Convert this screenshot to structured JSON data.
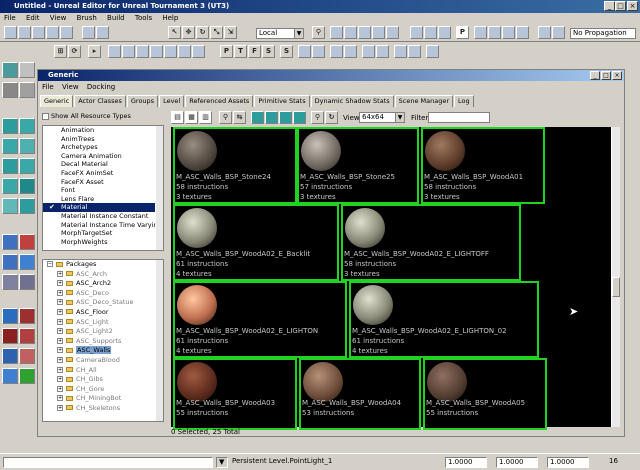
{
  "app": {
    "title": "Untitled - Unreal Editor for Unreal Tournament 3 (UT3)",
    "menu": [
      "File",
      "Edit",
      "View",
      "Brush",
      "Build",
      "Tools",
      "Help"
    ]
  },
  "main_toolbar": {
    "coord_system": "Local",
    "propagation": "No Propagation",
    "letter_buttons": [
      "P",
      "T",
      "F",
      "S",
      "S"
    ],
    "p_button": "P"
  },
  "generic": {
    "title": "Generic",
    "menu": [
      "File",
      "View",
      "Docking"
    ],
    "tabs": [
      "Generic",
      "Actor Classes",
      "Groups",
      "Level",
      "Referenced Assets",
      "Primitive Stats",
      "Dynamic Shadow Stats",
      "Scene Manager",
      "Log"
    ],
    "show_all_label": "Show All Resource Types",
    "resource_types": [
      {
        "label": "Animation",
        "checked": false,
        "selected": false
      },
      {
        "label": "AnimTrees",
        "checked": false,
        "selected": false
      },
      {
        "label": "Archetypes",
        "checked": false,
        "selected": false
      },
      {
        "label": "Camera Animation",
        "checked": false,
        "selected": false
      },
      {
        "label": "Decal Material",
        "checked": false,
        "selected": false
      },
      {
        "label": "FaceFX AnimSet",
        "checked": false,
        "selected": false
      },
      {
        "label": "FaceFX Asset",
        "checked": false,
        "selected": false
      },
      {
        "label": "Font",
        "checked": false,
        "selected": false
      },
      {
        "label": "Lens Flare",
        "checked": false,
        "selected": false
      },
      {
        "label": "Material",
        "checked": true,
        "selected": true
      },
      {
        "label": "Material Instance Constant",
        "checked": false,
        "selected": false
      },
      {
        "label": "Material Instance Time Varying",
        "checked": false,
        "selected": false
      },
      {
        "label": "MorphTargetSet",
        "checked": false,
        "selected": false
      },
      {
        "label": "MorphWeights",
        "checked": false,
        "selected": false
      }
    ],
    "packages_root": "Packages",
    "packages": [
      {
        "label": "ASC_Arch",
        "bold": false,
        "selected": false
      },
      {
        "label": "ASC_Arch2",
        "bold": true,
        "selected": false
      },
      {
        "label": "ASC_Deco",
        "bold": false,
        "selected": false
      },
      {
        "label": "ASC_Deco_Statue",
        "bold": false,
        "selected": false
      },
      {
        "label": "ASC_Floor",
        "bold": true,
        "selected": false
      },
      {
        "label": "ASC_Light",
        "bold": false,
        "selected": false
      },
      {
        "label": "ASC_Light2",
        "bold": false,
        "selected": false
      },
      {
        "label": "ASC_Supports",
        "bold": false,
        "selected": false
      },
      {
        "label": "ASC_Walls",
        "bold": true,
        "selected": true
      },
      {
        "label": "CameraBlood",
        "bold": false,
        "selected": false
      },
      {
        "label": "CH_All",
        "bold": false,
        "selected": false
      },
      {
        "label": "CH_Gibs",
        "bold": false,
        "selected": false
      },
      {
        "label": "CH_Gore",
        "bold": false,
        "selected": false
      },
      {
        "label": "CH_MiningBot",
        "bold": false,
        "selected": false
      },
      {
        "label": "CH_Skeletons",
        "bold": false,
        "selected": false
      }
    ],
    "view_label": "View",
    "view_size": "64x64",
    "filter_label": "Filter",
    "filter_value": "",
    "thumbnails": [
      {
        "name": "M_ASC_Walls_BSP_Stone24",
        "instructions": "58 instructions",
        "textures": "3 textures",
        "sphere": "s1"
      },
      {
        "name": "M_ASC_Walls_BSP_Stone25",
        "instructions": "57 instructions",
        "textures": "3 textures",
        "sphere": "s2"
      },
      {
        "name": "M_ASC_Walls_BSP_WoodA01",
        "instructions": "58 instructions",
        "textures": "3 textures",
        "sphere": "s3"
      },
      {
        "name": "M_ASC_Walls_BSP_WoodA02_E_Backlit",
        "instructions": "61 instructions",
        "textures": "4 textures",
        "sphere": "s4"
      },
      {
        "name": "M_ASC_Walls_BSP_WoodA02_E_LIGHTOFF",
        "instructions": "58 instructions",
        "textures": "3 textures",
        "sphere": "s4"
      },
      {
        "name": "M_ASC_Walls_BSP_WoodA02_E_LIGHTON",
        "instructions": "61 instructions",
        "textures": "4 textures",
        "sphere": "s5"
      },
      {
        "name": "M_ASC_Walls_BSP_WoodA02_E_LIGHTON_02",
        "instructions": "61 instructions",
        "textures": "4 textures",
        "sphere": "s4"
      },
      {
        "name": "M_ASC_Walls_BSP_WoodA03",
        "instructions": "55 instructions",
        "textures": "",
        "sphere": "s6"
      },
      {
        "name": "M_ASC_Walls_BSP_WoodA04",
        "instructions": "53 instructions",
        "textures": "",
        "sphere": "s7"
      },
      {
        "name": "M_ASC_Walls_BSP_WoodA05",
        "instructions": "55 instructions",
        "textures": "",
        "sphere": "s8"
      }
    ],
    "status": "0 Selected, 25 Total"
  },
  "statusbar": {
    "actor": "Persistent Level.PointLight_1",
    "x": "1.0000",
    "y": "1.0000",
    "z": "1.0000",
    "grid": "16"
  },
  "colors": {
    "thumb_border": "#21d321",
    "title_blue": "#0a246a"
  }
}
